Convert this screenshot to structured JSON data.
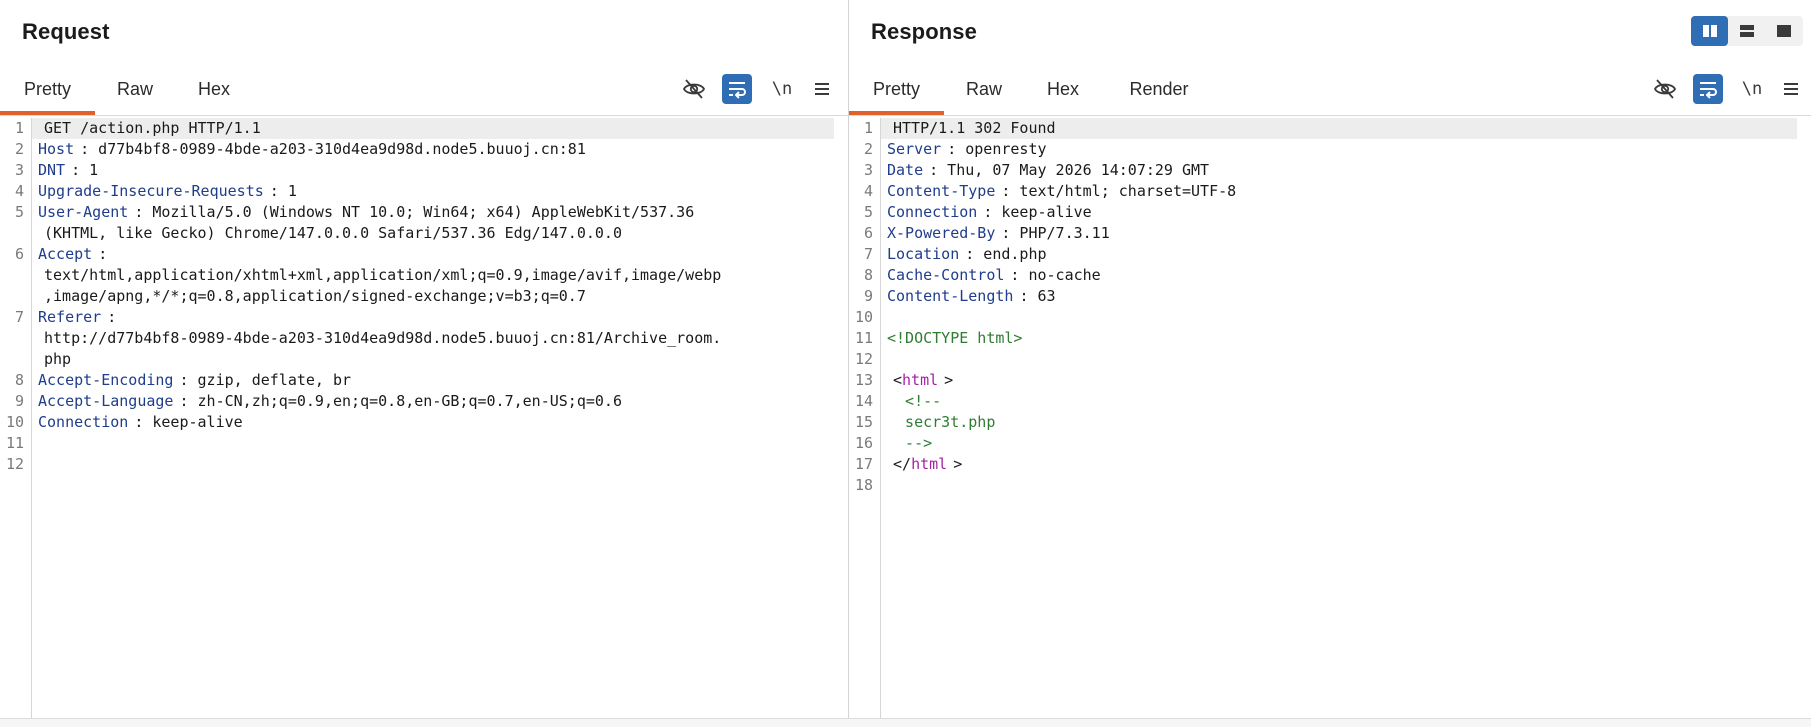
{
  "request": {
    "title": "Request",
    "tabs": [
      "Pretty",
      "Raw",
      "Hex"
    ],
    "active_tab": "Pretty",
    "lines": [
      {
        "n": "1",
        "parts": [
          {
            "t": "GET /action.php HTTP/1.1",
            "c": "txt"
          }
        ]
      },
      {
        "n": "2",
        "parts": [
          {
            "t": "Host",
            "c": "k"
          },
          {
            "t": ": d77b4bf8-0989-4bde-a203-310d4ea9d98d.node5.buuoj.cn:81",
            "c": "txt"
          }
        ]
      },
      {
        "n": "3",
        "parts": [
          {
            "t": "DNT",
            "c": "k"
          },
          {
            "t": ": 1",
            "c": "txt"
          }
        ]
      },
      {
        "n": "4",
        "parts": [
          {
            "t": "Upgrade-Insecure-Requests",
            "c": "k"
          },
          {
            "t": ": 1",
            "c": "txt"
          }
        ]
      },
      {
        "n": "5",
        "parts": [
          {
            "t": "User-Agent",
            "c": "k"
          },
          {
            "t": ": Mozilla/5.0 (Windows NT 10.0; Win64; x64) AppleWebKit/537.36",
            "c": "txt"
          }
        ]
      },
      {
        "n": "",
        "parts": [
          {
            "t": "(KHTML, like Gecko) Chrome/147.0.0.0 Safari/537.36 Edg/147.0.0.0",
            "c": "txt"
          }
        ]
      },
      {
        "n": "6",
        "parts": [
          {
            "t": "Accept",
            "c": "k"
          },
          {
            "t": ":",
            "c": "txt"
          }
        ]
      },
      {
        "n": "",
        "parts": [
          {
            "t": "text/html,application/xhtml+xml,application/xml;q=0.9,image/avif,image/webp",
            "c": "txt"
          }
        ]
      },
      {
        "n": "",
        "parts": [
          {
            "t": ",image/apng,*/*;q=0.8,application/signed-exchange;v=b3;q=0.7",
            "c": "txt"
          }
        ]
      },
      {
        "n": "7",
        "parts": [
          {
            "t": "Referer",
            "c": "k"
          },
          {
            "t": ":",
            "c": "txt"
          }
        ]
      },
      {
        "n": "",
        "parts": [
          {
            "t": "http://d77b4bf8-0989-4bde-a203-310d4ea9d98d.node5.buuoj.cn:81/Archive_room.",
            "c": "txt"
          }
        ]
      },
      {
        "n": "",
        "parts": [
          {
            "t": "php",
            "c": "txt"
          }
        ]
      },
      {
        "n": "8",
        "parts": [
          {
            "t": "Accept-Encoding",
            "c": "k"
          },
          {
            "t": ": gzip, deflate, br",
            "c": "txt"
          }
        ]
      },
      {
        "n": "9",
        "parts": [
          {
            "t": "Accept-Language",
            "c": "k"
          },
          {
            "t": ": zh-CN,zh;q=0.9,en;q=0.8,en-GB;q=0.7,en-US;q=0.6",
            "c": "txt"
          }
        ]
      },
      {
        "n": "10",
        "parts": [
          {
            "t": "Connection",
            "c": "k"
          },
          {
            "t": ": keep-alive",
            "c": "txt"
          }
        ]
      },
      {
        "n": "11",
        "parts": []
      },
      {
        "n": "12",
        "parts": []
      }
    ]
  },
  "response": {
    "title": "Response",
    "tabs": [
      "Pretty",
      "Raw",
      "Hex",
      "Render"
    ],
    "active_tab": "Pretty",
    "lines": [
      {
        "n": "1",
        "parts": [
          {
            "t": "HTTP/1.1 302 Found",
            "c": "txt"
          }
        ]
      },
      {
        "n": "2",
        "parts": [
          {
            "t": "Server",
            "c": "k"
          },
          {
            "t": ": openresty",
            "c": "txt"
          }
        ]
      },
      {
        "n": "3",
        "parts": [
          {
            "t": "Date",
            "c": "k"
          },
          {
            "t": ": Thu, 07 May 2026 14:07:29 GMT",
            "c": "txt"
          }
        ]
      },
      {
        "n": "4",
        "parts": [
          {
            "t": "Content-Type",
            "c": "k"
          },
          {
            "t": ": text/html; charset=UTF-8",
            "c": "txt"
          }
        ]
      },
      {
        "n": "5",
        "parts": [
          {
            "t": "Connection",
            "c": "k"
          },
          {
            "t": ": keep-alive",
            "c": "txt"
          }
        ]
      },
      {
        "n": "6",
        "parts": [
          {
            "t": "X-Powered-By",
            "c": "k"
          },
          {
            "t": ": PHP/7.3.11",
            "c": "txt"
          }
        ]
      },
      {
        "n": "7",
        "parts": [
          {
            "t": "Location",
            "c": "k"
          },
          {
            "t": ": end.php",
            "c": "txt"
          }
        ]
      },
      {
        "n": "8",
        "parts": [
          {
            "t": "Cache-Control",
            "c": "k"
          },
          {
            "t": ": no-cache",
            "c": "txt"
          }
        ]
      },
      {
        "n": "9",
        "parts": [
          {
            "t": "Content-Length",
            "c": "k"
          },
          {
            "t": ": 63",
            "c": "txt"
          }
        ]
      },
      {
        "n": "10",
        "parts": []
      },
      {
        "n": "11",
        "parts": [
          {
            "t": "<!DOCTYPE html>",
            "c": "cm"
          }
        ]
      },
      {
        "n": "12",
        "parts": []
      },
      {
        "n": "13",
        "parts": [
          {
            "t": "<",
            "c": "txt"
          },
          {
            "t": "html",
            "c": "tagc"
          },
          {
            "t": ">",
            "c": "txt"
          }
        ]
      },
      {
        "n": "14",
        "parts": [
          {
            "t": "  <!--",
            "c": "cm"
          }
        ]
      },
      {
        "n": "15",
        "parts": [
          {
            "t": "  secr3t.php",
            "c": "cm"
          }
        ]
      },
      {
        "n": "16",
        "parts": [
          {
            "t": "  -->",
            "c": "cm"
          }
        ]
      },
      {
        "n": "17",
        "parts": [
          {
            "t": "</",
            "c": "txt"
          },
          {
            "t": "html",
            "c": "tagc"
          },
          {
            "t": ">",
            "c": "txt"
          }
        ]
      },
      {
        "n": "18",
        "parts": []
      }
    ]
  },
  "tools": {
    "newline_label": "\\n",
    "icons": [
      "hide-non-printing-icon",
      "wrap-lines-icon",
      "newline-toggle-icon",
      "menu-icon"
    ]
  },
  "layout_switch": {
    "icons": [
      "split-vertical-icon",
      "split-horizontal-icon",
      "single-pane-icon"
    ],
    "active_index": 0
  },
  "colors": {
    "accent": "#e0612b",
    "active_tool": "#2f6db5",
    "header_name": "#1f3d8c",
    "tag": "#a422a4",
    "comment": "#2e7d32"
  }
}
